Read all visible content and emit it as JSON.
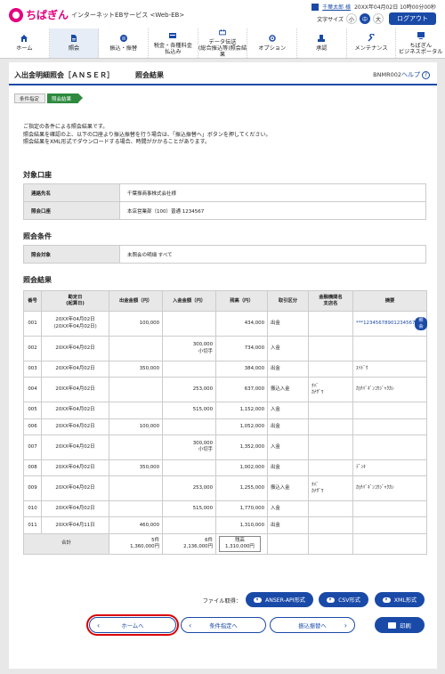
{
  "header": {
    "logo": "ちばぎん",
    "service_name": "インターネットEBサービス <Web-EB>",
    "user_name": "千葉太郎 様",
    "last_login": "20XX年04月02日 10時00分00秒",
    "font_size_label": "文字サイズ",
    "font_sizes": [
      "小",
      "中",
      "大"
    ],
    "logout_label": "ログアウト"
  },
  "gnav": [
    {
      "label": "ホーム",
      "icon": "home-icon"
    },
    {
      "label": "照会",
      "icon": "document-icon"
    },
    {
      "label": "振込・振替",
      "icon": "transfer-icon"
    },
    {
      "label": "税金・各種料金\n払込み",
      "icon": "tax-icon"
    },
    {
      "label": "データ伝送\n(総合振込等)照会結果",
      "icon": "data-transmission-icon"
    },
    {
      "label": "オプション",
      "icon": "option-icon"
    },
    {
      "label": "承認",
      "icon": "approval-icon"
    },
    {
      "label": "メンテナンス",
      "icon": "maintenance-icon"
    },
    {
      "label": "ちばぎん\nビジネスポータル",
      "icon": "portal-icon"
    }
  ],
  "page": {
    "title": "入出金明細照会［ＡＮＳＥＲ］",
    "subtitle": "照会結果",
    "screen_id": "BNMR002",
    "help_label": "ヘルプ"
  },
  "steps": [
    "条件指定",
    "照会結果"
  ],
  "guide": [
    "ご指定の条件による照会結果です。",
    "照会結果を確認の上、以下の口座より振込振替を行う場合は、「振込振替へ」ボタンを押してください。",
    "照会結果をXML形式でダウンロードする場合、時間がかかることがあります。"
  ],
  "target_account": {
    "heading": "対象口座",
    "rows": [
      {
        "key": "連絡先名",
        "value": "千葉振商事株式会社様"
      },
      {
        "key": "照会口座",
        "value": "本店営業部（100）普通 1234567"
      }
    ]
  },
  "conditions": {
    "heading": "照会条件",
    "rows": [
      {
        "key": "照会対象",
        "value": "未照会の明細 すべて"
      }
    ]
  },
  "results": {
    "heading": "照会結果",
    "columns": [
      "番号",
      "勘定日\n(起算日)",
      "出金金額（円）",
      "入金金額（円）",
      "残高（円）",
      "取引区分",
      "金融機関名\n支店名",
      "摘要"
    ],
    "rows": [
      {
        "no": "001",
        "date": "20XX年04月02日\n(20XX年04月02日)",
        "out": "100,000",
        "in": "",
        "bal": "434,000",
        "type": "出金",
        "bank": "",
        "memo": "***12345678901234567",
        "memo_btn": "照会"
      },
      {
        "no": "002",
        "date": "20XX年04月02日",
        "out": "",
        "in": "300,000\n小切手",
        "bal": "734,000",
        "type": "入金",
        "bank": "",
        "memo": ""
      },
      {
        "no": "003",
        "date": "20XX年04月02日",
        "out": "350,000",
        "in": "",
        "bal": "384,000",
        "type": "出金",
        "bank": "",
        "memo": "ｽｲﾄﾞｳ"
      },
      {
        "no": "004",
        "date": "20XX年04月02日",
        "out": "",
        "in": "253,000",
        "bal": "637,000",
        "type": "振込入金",
        "bank": "ﾁﾊﾞ\nｶﾅｻﾞﾜ",
        "memo": "ｶ)ﾁﾊﾞｷﾞﾝｺｳｼﾞｬｸｶﾝ"
      },
      {
        "no": "005",
        "date": "20XX年04月02日",
        "out": "",
        "in": "515,000",
        "bal": "1,152,000",
        "type": "入金",
        "bank": "",
        "memo": ""
      },
      {
        "no": "006",
        "date": "20XX年04月02日",
        "out": "100,000",
        "in": "",
        "bal": "1,052,000",
        "type": "出金",
        "bank": "",
        "memo": ""
      },
      {
        "no": "007",
        "date": "20XX年04月02日",
        "out": "",
        "in": "300,000\n小切手",
        "bal": "1,352,000",
        "type": "入金",
        "bank": "",
        "memo": ""
      },
      {
        "no": "008",
        "date": "20XX年04月02日",
        "out": "350,000",
        "in": "",
        "bal": "1,002,000",
        "type": "出金",
        "bank": "",
        "memo": "ﾃﾞﾝｷ"
      },
      {
        "no": "009",
        "date": "20XX年04月02日",
        "out": "",
        "in": "253,000",
        "bal": "1,255,000",
        "type": "振込入金",
        "bank": "ﾁﾊﾞ\nｶﾅｻﾞﾜ",
        "memo": "ｶ)ﾁﾊﾞｷﾞﾝｺｳｼﾞｬｸｶﾝ"
      },
      {
        "no": "010",
        "date": "20XX年04月02日",
        "out": "",
        "in": "515,000",
        "bal": "1,770,000",
        "type": "入金",
        "bank": "",
        "memo": ""
      },
      {
        "no": "011",
        "date": "20XX年04月11日",
        "out": "460,000",
        "in": "",
        "bal": "1,310,000",
        "type": "出金",
        "bank": "",
        "memo": ""
      }
    ],
    "total": {
      "label": "合計",
      "out_count": "5件",
      "out_sum": "1,360,000円",
      "in_count": "6件",
      "in_sum": "2,136,000円",
      "bal_label": "残高",
      "bal_value": "1,310,000円"
    }
  },
  "download": {
    "label": "ファイル取得：",
    "buttons": [
      "ANSER-API形式",
      "CSV形式",
      "XML形式"
    ]
  },
  "nav_buttons": {
    "home": "ホームへ",
    "condition": "条件指定へ",
    "transfer": "振込振替へ",
    "print": "印刷"
  },
  "colors": {
    "brand": "#e4007f",
    "accent": "#1a4aa8",
    "step_active": "#2d8a3e",
    "highlight": "#d90000"
  }
}
